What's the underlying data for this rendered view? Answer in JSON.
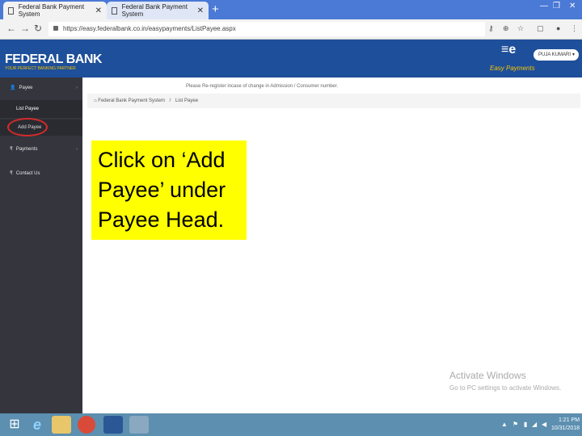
{
  "browser": {
    "tabs": [
      {
        "title": "Federal Bank Payment System"
      },
      {
        "title": "Federal Bank Payment System"
      }
    ],
    "url": "https://easy.federalbank.co.in/easypayments/ListPayee.aspx"
  },
  "header": {
    "bank_name": "FEDERAL BANK",
    "tagline": "YOUR PERFECT BANKING PARTNER",
    "app_name": "Easy Payments",
    "user_name": "PUJA KUMARI"
  },
  "sidebar": {
    "payee": "Payee",
    "list_payee": "List Payee",
    "add_payee": "Add Payee",
    "payments": "Payments",
    "contact_us": "Contact Us"
  },
  "main": {
    "notice": "Please Re-register incase of change in Admission / Consumer number.",
    "breadcrumb_home": "Federal Bank Payment System",
    "breadcrumb_sep": "/",
    "breadcrumb_page": "List Payee"
  },
  "callout": {
    "text": "Click on ‘Add Payee’ under Payee Head."
  },
  "watermark": {
    "line1": "Activate Windows",
    "line2": "Go to PC settings to activate Windows."
  },
  "taskbar": {
    "time": "1:21 PM",
    "date": "10/31/2018"
  },
  "colors": {
    "header": "#1e4f9a",
    "sidebar": "#34353d",
    "callout": "#ffff00",
    "highlight": "#d62a2a"
  }
}
